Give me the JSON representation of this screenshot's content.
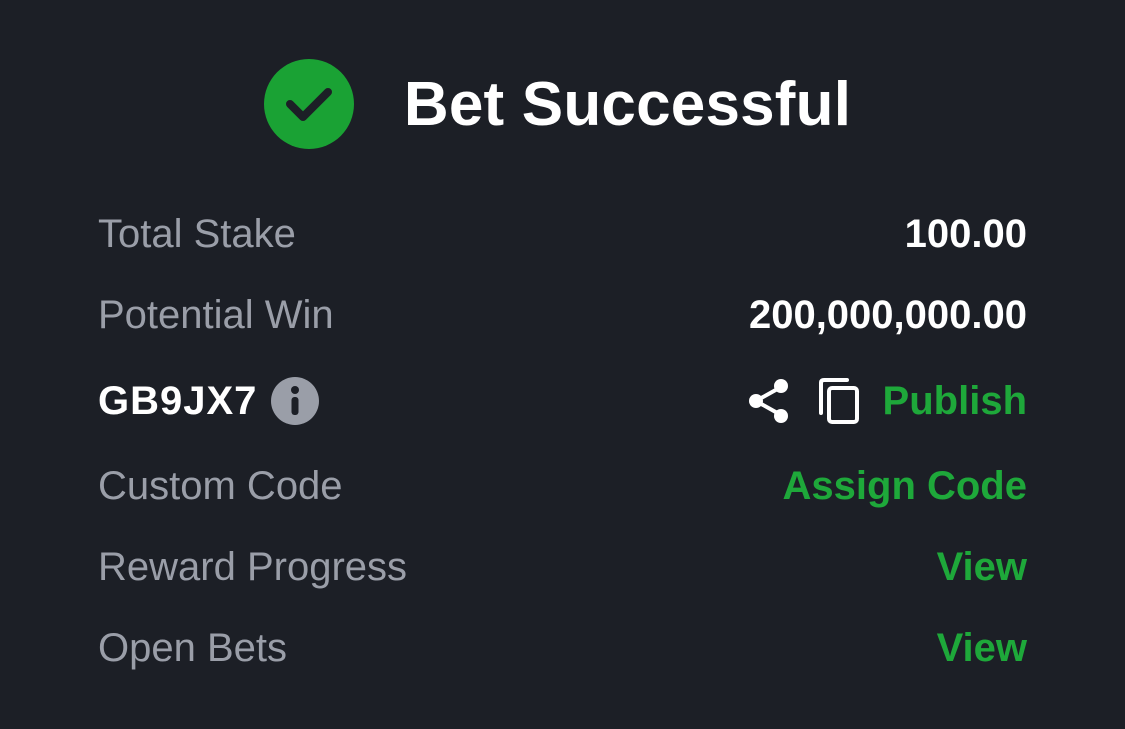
{
  "header": {
    "title": "Bet Successful",
    "status_icon": "check-circle-icon",
    "accent_color": "#1aa234"
  },
  "rows": {
    "total_stake": {
      "label": "Total Stake",
      "value": "100.00"
    },
    "potential_win": {
      "label": "Potential Win",
      "value": "200,000,000.00"
    },
    "booking_code": {
      "code": "GB9JX7",
      "info_icon": "info-icon",
      "share_icon": "share-icon",
      "copy_icon": "copy-icon",
      "publish_label": "Publish"
    },
    "custom_code": {
      "label": "Custom Code",
      "action": "Assign Code"
    },
    "reward_progress": {
      "label": "Reward Progress",
      "action": "View"
    },
    "open_bets": {
      "label": "Open Bets",
      "action": "View"
    }
  },
  "colors": {
    "background": "#1c1f26",
    "label": "#9a9ea8",
    "value": "#ffffff",
    "link": "#1ea83a"
  }
}
